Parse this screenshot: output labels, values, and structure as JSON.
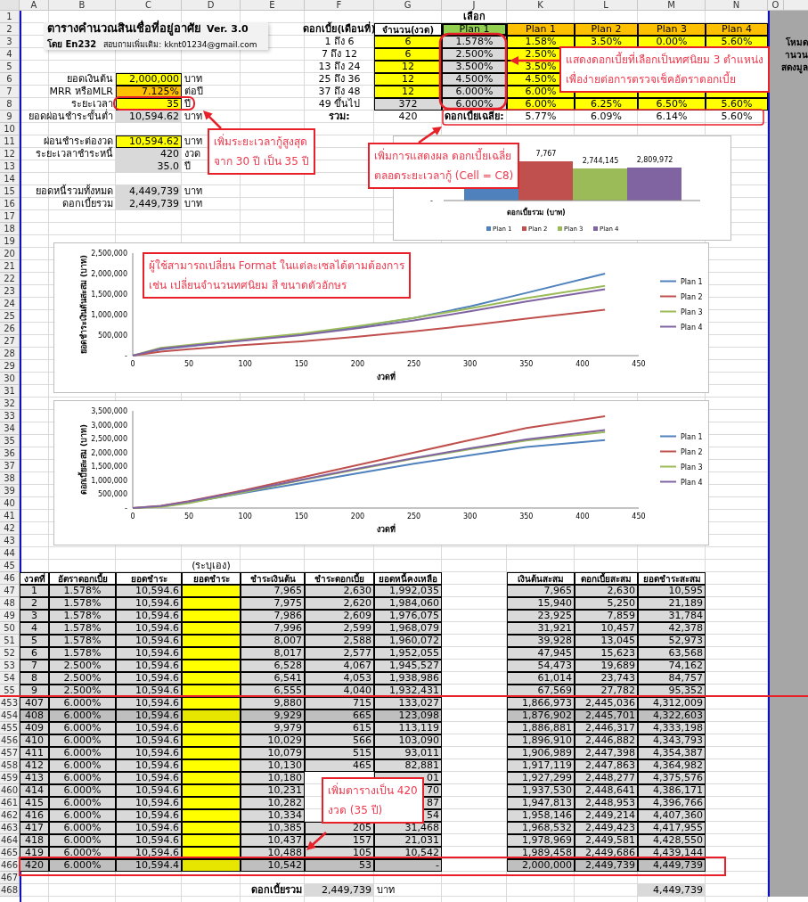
{
  "column_headers": [
    "A",
    "B",
    "C",
    "D",
    "E",
    "F",
    "G",
    "J",
    "K",
    "L",
    "M",
    "N",
    "O"
  ],
  "title_block": {
    "title": "ตารางคำนวณสินเชื่อที่อยู่อาศัย",
    "version": "Ver. 3.0",
    "author": "โดย En232",
    "contact": "สอบถามเพิ่มเติม: kknt01234@gmail.com"
  },
  "side_note": [
    "โหมด",
    "านวน",
    "สดงมูล"
  ],
  "rows": [
    {
      "number": "1",
      "J": {
        "text": "เลือก",
        "kind": "center-bold"
      }
    },
    {
      "number": "2",
      "F": {
        "text": "ดอกเบี้ย(เดือนที่)",
        "kind": "center-bold"
      },
      "G": {
        "text": "จำนวน(งวด)",
        "kind": "head"
      },
      "J": {
        "text": "Plan 1",
        "kind": "selected-head"
      },
      "K": {
        "text": "Plan 1",
        "kind": "plan-head"
      },
      "L": {
        "text": "Plan 2",
        "kind": "plan-head"
      },
      "M": {
        "text": "Plan 3",
        "kind": "plan-head"
      },
      "N": {
        "text": "Plan 4",
        "kind": "plan-head"
      }
    },
    {
      "number": "3",
      "F": {
        "text": "1 ถึง  6",
        "kind": "center"
      },
      "G": {
        "text": "6",
        "kind": "rate"
      },
      "J": {
        "text": "1.578%",
        "kind": "selected-rate"
      },
      "K": {
        "text": "1.58%",
        "kind": "rate"
      },
      "L": {
        "text": "3.50%",
        "kind": "rate"
      },
      "M": {
        "text": "0.00%",
        "kind": "rate"
      },
      "N": {
        "text": "5.60%",
        "kind": "rate"
      }
    },
    {
      "number": "4",
      "F": {
        "text": "7 ถึง  12",
        "kind": "center"
      },
      "G": {
        "text": "6",
        "kind": "rate"
      },
      "J": {
        "text": "2.500%",
        "kind": "selected-rate"
      },
      "K": {
        "text": "2.50%",
        "kind": "rate"
      },
      "L": {
        "kind": "rate"
      },
      "M": {
        "kind": "rate"
      },
      "N": {
        "kind": "rate"
      }
    },
    {
      "number": "5",
      "F": {
        "text": "13 ถึง  24",
        "kind": "center"
      },
      "G": {
        "text": "12",
        "kind": "rate"
      },
      "J": {
        "text": "3.500%",
        "kind": "selected-rate"
      },
      "K": {
        "text": "3.50%",
        "kind": "rate"
      },
      "L": {
        "kind": "rate"
      },
      "M": {
        "kind": "rate"
      },
      "N": {
        "kind": "rate"
      }
    },
    {
      "number": "6",
      "B": {
        "text": "ยอดเงินต้น",
        "kind": "label"
      },
      "C": {
        "text": "2,000,000",
        "kind": "input"
      },
      "D": {
        "text": "บาท",
        "kind": "unit"
      },
      "F": {
        "text": "25 ถึง  36",
        "kind": "center"
      },
      "G": {
        "text": "12",
        "kind": "rate"
      },
      "J": {
        "text": "4.500%",
        "kind": "selected-rate"
      },
      "K": {
        "text": "4.50%",
        "kind": "rate"
      },
      "L": {
        "kind": "rate"
      },
      "M": {
        "kind": "rate"
      },
      "N": {
        "kind": "rate"
      }
    },
    {
      "number": "7",
      "B": {
        "text": "MRR หรือMLR",
        "kind": "label"
      },
      "C": {
        "text": "7.125%",
        "kind": "rate-input"
      },
      "D": {
        "text": "ต่อปี",
        "kind": "unit"
      },
      "F": {
        "text": "37 ถึง  48",
        "kind": "center"
      },
      "G": {
        "text": "12",
        "kind": "rate"
      },
      "J": {
        "text": "6.000%",
        "kind": "selected-rate"
      },
      "K": {
        "text": "6.00%",
        "kind": "rate"
      },
      "L": {
        "kind": "rate"
      },
      "M": {
        "kind": "rate"
      },
      "N": {
        "kind": "rate"
      }
    },
    {
      "number": "8",
      "B": {
        "text": "ระยะเวลา",
        "kind": "label"
      },
      "C": {
        "text": "35",
        "kind": "input"
      },
      "D": {
        "text": "ปี",
        "kind": "unit"
      },
      "F": {
        "text": "49 ขึ้นไป",
        "kind": "center"
      },
      "G": {
        "text": "372",
        "kind": "calc-center"
      },
      "J": {
        "text": "6.000%",
        "kind": "selected-rate"
      },
      "K": {
        "text": "6.00%",
        "kind": "rate"
      },
      "L": {
        "text": "6.25%",
        "kind": "rate"
      },
      "M": {
        "text": "6.50%",
        "kind": "rate"
      },
      "N": {
        "text": "5.60%",
        "kind": "rate"
      }
    },
    {
      "number": "9",
      "B": {
        "text": "ยอดผ่อนชำระขั้นต่ำ",
        "kind": "label"
      },
      "C": {
        "text": "10,594.62",
        "kind": "calc"
      },
      "D": {
        "text": "บาท",
        "kind": "unit"
      },
      "F": {
        "text": "รวม:",
        "kind": "center-bold"
      },
      "G": {
        "text": "420",
        "kind": "center"
      },
      "J": {
        "text": "ดอกเบี้ยเฉลี่ย:",
        "kind": "center-bold"
      },
      "K": {
        "text": "5.77%",
        "kind": "center"
      },
      "L": {
        "text": "6.09%",
        "kind": "center"
      },
      "M": {
        "text": "6.14%",
        "kind": "center"
      },
      "N": {
        "text": "5.60%",
        "kind": "center"
      }
    },
    {
      "number": "10"
    },
    {
      "number": "11",
      "B": {
        "text": "ผ่อนชำระต่องวด",
        "kind": "label"
      },
      "C": {
        "text": "10,594.62",
        "kind": "input"
      },
      "D": {
        "text": "บาท",
        "kind": "unit"
      }
    },
    {
      "number": "12",
      "B": {
        "text": "ระยะเวลาชำระหนี้",
        "kind": "label"
      },
      "C": {
        "text": "420",
        "kind": "calc"
      },
      "D": {
        "text": "งวด",
        "kind": "unit"
      }
    },
    {
      "number": "13",
      "C": {
        "text": "35.0",
        "kind": "calc"
      },
      "D": {
        "text": "ปี",
        "kind": "unit"
      }
    },
    {
      "number": "14"
    },
    {
      "number": "15",
      "B": {
        "text": "ยอดหนี้รวมทั้งหมด",
        "kind": "label"
      },
      "C": {
        "text": "4,449,739",
        "kind": "calc"
      },
      "D": {
        "text": "บาท",
        "kind": "unit"
      }
    },
    {
      "number": "16",
      "B": {
        "text": "ดอกเบี้ยรวม",
        "kind": "label"
      },
      "C": {
        "text": "2,449,739",
        "kind": "calc"
      },
      "D": {
        "text": "บาท",
        "kind": "unit"
      }
    },
    {
      "number": "17"
    },
    {
      "number": "18"
    },
    {
      "number": "19"
    },
    {
      "number": "20"
    },
    {
      "number": "21"
    },
    {
      "number": "22"
    },
    {
      "number": "23"
    },
    {
      "number": "24"
    },
    {
      "number": "25"
    },
    {
      "number": "26"
    },
    {
      "number": "27"
    },
    {
      "number": "28"
    },
    {
      "number": "29"
    },
    {
      "number": "30"
    },
    {
      "number": "31"
    },
    {
      "number": "32"
    },
    {
      "number": "33"
    },
    {
      "number": "34"
    },
    {
      "number": "35"
    },
    {
      "number": "36"
    },
    {
      "number": "37"
    },
    {
      "number": "38"
    },
    {
      "number": "39"
    },
    {
      "number": "40"
    },
    {
      "number": "41"
    },
    {
      "number": "42"
    },
    {
      "number": "43"
    },
    {
      "number": "44"
    },
    {
      "number": "45",
      "D": {
        "text": "(ระบุเอง)",
        "kind": "center"
      }
    },
    {
      "number": "46",
      "A": {
        "text": "งวดที่",
        "kind": "head"
      },
      "B": {
        "text": "อัตราดอกเบี้ย",
        "kind": "head"
      },
      "C": {
        "text": "ยอดชำระ",
        "kind": "head"
      },
      "D": {
        "text": "ยอดชำระ",
        "kind": "head"
      },
      "E": {
        "text": "ชำระเงินต้น",
        "kind": "head"
      },
      "F": {
        "text": "ชำระดอกเบี้ย",
        "kind": "head"
      },
      "G": {
        "text": "ยอดหนี้คงเหลือ",
        "kind": "head"
      },
      "K": {
        "text": "เงินต้นสะสม",
        "kind": "head"
      },
      "L": {
        "text": "ดอกเบี้ยสะสม",
        "kind": "head"
      },
      "M": {
        "text": "ยอดชำระสะสม",
        "kind": "head"
      }
    }
  ],
  "schedule": [
    {
      "number": "47",
      "shaded": false,
      "period": "1",
      "rate": "1.578%",
      "payment": "10,594.6",
      "principal": "7,965",
      "interest": "2,630",
      "balance": "1,992,035",
      "cum_principal": "7,965",
      "cum_interest": "2,630",
      "cum_total": "10,595"
    },
    {
      "number": "48",
      "shaded": false,
      "period": "2",
      "rate": "1.578%",
      "payment": "10,594.6",
      "principal": "7,975",
      "interest": "2,620",
      "balance": "1,984,060",
      "cum_principal": "15,940",
      "cum_interest": "5,250",
      "cum_total": "21,189"
    },
    {
      "number": "49",
      "shaded": false,
      "period": "3",
      "rate": "1.578%",
      "payment": "10,594.6",
      "principal": "7,986",
      "interest": "2,609",
      "balance": "1,976,075",
      "cum_principal": "23,925",
      "cum_interest": "7,859",
      "cum_total": "31,784"
    },
    {
      "number": "50",
      "shaded": false,
      "period": "4",
      "rate": "1.578%",
      "payment": "10,594.6",
      "principal": "7,996",
      "interest": "2,599",
      "balance": "1,968,079",
      "cum_principal": "31,921",
      "cum_interest": "10,457",
      "cum_total": "42,378"
    },
    {
      "number": "51",
      "shaded": false,
      "period": "5",
      "rate": "1.578%",
      "payment": "10,594.6",
      "principal": "8,007",
      "interest": "2,588",
      "balance": "1,960,072",
      "cum_principal": "39,928",
      "cum_interest": "13,045",
      "cum_total": "52,973"
    },
    {
      "number": "52",
      "shaded": false,
      "period": "6",
      "rate": "1.578%",
      "payment": "10,594.6",
      "principal": "8,017",
      "interest": "2,577",
      "balance": "1,952,055",
      "cum_principal": "47,945",
      "cum_interest": "15,623",
      "cum_total": "63,568"
    },
    {
      "number": "53",
      "shaded": false,
      "period": "7",
      "rate": "2.500%",
      "payment": "10,594.6",
      "principal": "6,528",
      "interest": "4,067",
      "balance": "1,945,527",
      "cum_principal": "54,473",
      "cum_interest": "19,689",
      "cum_total": "74,162"
    },
    {
      "number": "54",
      "shaded": false,
      "period": "8",
      "rate": "2.500%",
      "payment": "10,594.6",
      "principal": "6,541",
      "interest": "4,053",
      "balance": "1,938,986",
      "cum_principal": "61,014",
      "cum_interest": "23,743",
      "cum_total": "84,757"
    },
    {
      "number": "55",
      "shaded": false,
      "period": "9",
      "rate": "2.500%",
      "payment": "10,594.6",
      "principal": "6,555",
      "interest": "4,040",
      "balance": "1,932,431",
      "cum_principal": "67,569",
      "cum_interest": "27,782",
      "cum_total": "95,352"
    },
    {
      "number": "453",
      "shaded": false,
      "period": "407",
      "rate": "6.000%",
      "payment": "10,594.6",
      "principal": "9,880",
      "interest": "715",
      "balance": "133,027",
      "cum_principal": "1,866,973",
      "cum_interest": "2,445,036",
      "cum_total": "4,312,009"
    },
    {
      "number": "454",
      "shaded": true,
      "period": "408",
      "rate": "6.000%",
      "payment": "10,594.6",
      "principal": "9,929",
      "interest": "665",
      "balance": "123,098",
      "cum_principal": "1,876,902",
      "cum_interest": "2,445,701",
      "cum_total": "4,322,603"
    },
    {
      "number": "455",
      "shaded": false,
      "period": "409",
      "rate": "6.000%",
      "payment": "10,594.6",
      "principal": "9,979",
      "interest": "615",
      "balance": "113,119",
      "cum_principal": "1,886,881",
      "cum_interest": "2,446,317",
      "cum_total": "4,333,198"
    },
    {
      "number": "456",
      "shaded": false,
      "period": "410",
      "rate": "6.000%",
      "payment": "10,594.6",
      "principal": "10,029",
      "interest": "566",
      "balance": "103,090",
      "cum_principal": "1,896,910",
      "cum_interest": "2,446,882",
      "cum_total": "4,343,793"
    },
    {
      "number": "457",
      "shaded": false,
      "period": "411",
      "rate": "6.000%",
      "payment": "10,594.6",
      "principal": "10,079",
      "interest": "515",
      "balance": "93,011",
      "cum_principal": "1,906,989",
      "cum_interest": "2,447,398",
      "cum_total": "4,354,387"
    },
    {
      "number": "458",
      "shaded": false,
      "period": "412",
      "rate": "6.000%",
      "payment": "10,594.6",
      "principal": "10,130",
      "interest": "465",
      "balance": "82,881",
      "cum_principal": "1,917,119",
      "cum_interest": "2,447,863",
      "cum_total": "4,364,982"
    },
    {
      "number": "459",
      "shaded": false,
      "period": "413",
      "rate": "6.000%",
      "payment": "10,594.6",
      "principal": "10,180",
      "balance": "01",
      "cum_principal": "1,927,299",
      "cum_interest": "2,448,277",
      "cum_total": "4,375,576"
    },
    {
      "number": "460",
      "shaded": false,
      "period": "414",
      "rate": "6.000%",
      "payment": "10,594.6",
      "principal": "10,231",
      "balance": "70",
      "cum_principal": "1,937,530",
      "cum_interest": "2,448,641",
      "cum_total": "4,386,171"
    },
    {
      "number": "461",
      "shaded": false,
      "period": "415",
      "rate": "6.000%",
      "payment": "10,594.6",
      "principal": "10,282",
      "balance": "87",
      "cum_principal": "1,947,813",
      "cum_interest": "2,448,953",
      "cum_total": "4,396,766"
    },
    {
      "number": "462",
      "shaded": false,
      "period": "416",
      "rate": "6.000%",
      "payment": "10,594.6",
      "principal": "10,334",
      "balance": "54",
      "cum_principal": "1,958,146",
      "cum_interest": "2,449,214",
      "cum_total": "4,407,360"
    },
    {
      "number": "463",
      "shaded": false,
      "period": "417",
      "rate": "6.000%",
      "payment": "10,594.6",
      "principal": "10,385",
      "interest": "205",
      "balance": "31,468",
      "cum_principal": "1,968,532",
      "cum_interest": "2,449,423",
      "cum_total": "4,417,955"
    },
    {
      "number": "464",
      "shaded": false,
      "period": "418",
      "rate": "6.000%",
      "payment": "10,594.6",
      "principal": "10,437",
      "interest": "157",
      "balance": "21,031",
      "cum_principal": "1,978,969",
      "cum_interest": "2,449,581",
      "cum_total": "4,428,550"
    },
    {
      "number": "465",
      "shaded": false,
      "period": "419",
      "rate": "6.000%",
      "payment": "10,594.6",
      "principal": "10,488",
      "interest": "105",
      "balance": "10,542",
      "cum_principal": "1,989,458",
      "cum_interest": "2,449,686",
      "cum_total": "4,439,144"
    },
    {
      "number": "466",
      "shaded": true,
      "period": "420",
      "rate": "6.000%",
      "payment": "10,594.4",
      "principal": "10,542",
      "interest": "53",
      "balance": "-",
      "cum_principal": "2,000,000",
      "cum_interest": "2,449,739",
      "cum_total": "4,449,739"
    }
  ],
  "footer_rows": [
    {
      "number": "467"
    },
    {
      "number": "468",
      "E": {
        "text": "ดอกเบี้ยรวม",
        "kind": "label-bold"
      },
      "F": {
        "text": "2,449,739",
        "kind": "calc"
      },
      "G": {
        "text": "บาท",
        "kind": "unit"
      },
      "M": {
        "text": "4,449,739",
        "kind": "calc"
      }
    }
  ],
  "bar_chart": {
    "axis_label": "ดอกเบี้ยรวม (บาท)",
    "zero_label": "-",
    "bars": [
      {
        "name": "Plan 1",
        "color": "#4f81bd"
      },
      {
        "name": "Plan 2",
        "color": "#c0504d",
        "label": "7,767"
      },
      {
        "name": "Plan 3",
        "color": "#9bbb59",
        "label": "2,744,145"
      },
      {
        "name": "Plan 4",
        "color": "#8064a2",
        "label": "2,809,972"
      }
    ]
  },
  "line_charts": [
    {
      "chart_data": {
        "type": "line",
        "xlabel": "งวดที่",
        "ylabel": "ยอดชำระเงินต้นสะสม (บาท)",
        "legend": "right",
        "x": [
          0,
          25,
          50,
          100,
          150,
          200,
          250,
          300,
          350,
          420
        ],
        "xlim": [
          0,
          450
        ],
        "ylim": [
          0,
          2500000
        ],
        "xticks": [
          0,
          50,
          100,
          150,
          200,
          250,
          300,
          350,
          400,
          450
        ],
        "yticks": [
          {
            "value": 0,
            "label": "-"
          },
          {
            "value": 500000,
            "label": "500,000"
          },
          {
            "value": 1000000,
            "label": "1,000,000"
          },
          {
            "value": 1500000,
            "label": "1,500,000"
          },
          {
            "value": 2000000,
            "label": "2,000,000"
          },
          {
            "value": 2500000,
            "label": "2,500,000"
          }
        ],
        "series": [
          {
            "name": "Plan 1",
            "color": "#4f81bd",
            "values": [
              0,
              150000,
              230000,
              380000,
              520000,
              700000,
              920000,
              1200000,
              1530000,
              2000000
            ]
          },
          {
            "name": "Plan 2",
            "color": "#c0504d",
            "values": [
              0,
              100000,
              160000,
              260000,
              350000,
              460000,
              590000,
              740000,
              900000,
              1120000
            ]
          },
          {
            "name": "Plan 3",
            "color": "#9bbb59",
            "values": [
              0,
              190000,
              260000,
              400000,
              540000,
              720000,
              920000,
              1150000,
              1400000,
              1700000
            ]
          },
          {
            "name": "Plan 4",
            "color": "#8064a2",
            "values": [
              0,
              170000,
              240000,
              370000,
              500000,
              670000,
              860000,
              1080000,
              1320000,
              1620000
            ]
          }
        ]
      }
    },
    {
      "chart_data": {
        "type": "line",
        "xlabel": "งวดที่",
        "ylabel": "ดอกเบี้ยสะสม (บาท)",
        "legend": "right",
        "x": [
          0,
          25,
          50,
          100,
          150,
          200,
          250,
          300,
          350,
          420
        ],
        "xlim": [
          0,
          450
        ],
        "ylim": [
          0,
          3500000
        ],
        "xticks": [
          0,
          50,
          100,
          150,
          200,
          250,
          300,
          350,
          400,
          450
        ],
        "yticks": [
          {
            "value": 0,
            "label": "-"
          },
          {
            "value": 500000,
            "label": "500,000"
          },
          {
            "value": 1000000,
            "label": "1,000,000"
          },
          {
            "value": 1500000,
            "label": "1,500,000"
          },
          {
            "value": 2000000,
            "label": "2,000,000"
          },
          {
            "value": 2500000,
            "label": "2,500,000"
          },
          {
            "value": 3000000,
            "label": "3,000,000"
          },
          {
            "value": 3500000,
            "label": "3,500,000"
          }
        ],
        "series": [
          {
            "name": "Plan 1",
            "color": "#4f81bd",
            "values": [
              null,
              null,
              200000,
              550000,
              900000,
              1250000,
              1600000,
              1900000,
              2200000,
              2450000
            ]
          },
          {
            "name": "Plan 2",
            "color": "#c0504d",
            "values": [
              0,
              80000,
              250000,
              650000,
              1100000,
              1550000,
              2000000,
              2450000,
              2880000,
              3310000
            ]
          },
          {
            "name": "Plan 3",
            "color": "#9bbb59",
            "values": [
              0,
              40000,
              180000,
              580000,
              1000000,
              1400000,
              1780000,
              2120000,
              2430000,
              2740000
            ]
          },
          {
            "name": "Plan 4",
            "color": "#8064a2",
            "values": [
              0,
              70000,
              230000,
              620000,
              1020000,
              1420000,
              1800000,
              2150000,
              2470000,
              2810000
            ]
          }
        ]
      }
    }
  ],
  "callouts": [
    {
      "lines": [
        "เพิ่มระยะเวลากู้สูงสุด",
        "จาก 30 ปี เป็น 35 ปี"
      ]
    },
    {
      "lines": [
        "แสดงดอกเบี้ยที่เลือกเป็นทศนิยม 3 ตำแหน่ง",
        "เพื่อง่ายต่อการตรวจเช็คอัตราดอกเบี้ย"
      ]
    },
    {
      "lines": [
        "เพิ่มการแสดงผล ดอกเบี้ยเฉลี่ย",
        "ตลอดระยะเวลากู้ (Cell = C8)"
      ]
    },
    {
      "lines": [
        "ผู้ใช้สามารถเปลี่ยน Format ในแต่ละเซลได้ตามต้องการ",
        "เช่น เปลี่ยนจำนวนทศนิยม สี ขนาดตัวอักษร"
      ]
    },
    {
      "lines": [
        "เพิ่มตารางเป็น 420",
        "งวด (35 ปี)"
      ]
    }
  ]
}
